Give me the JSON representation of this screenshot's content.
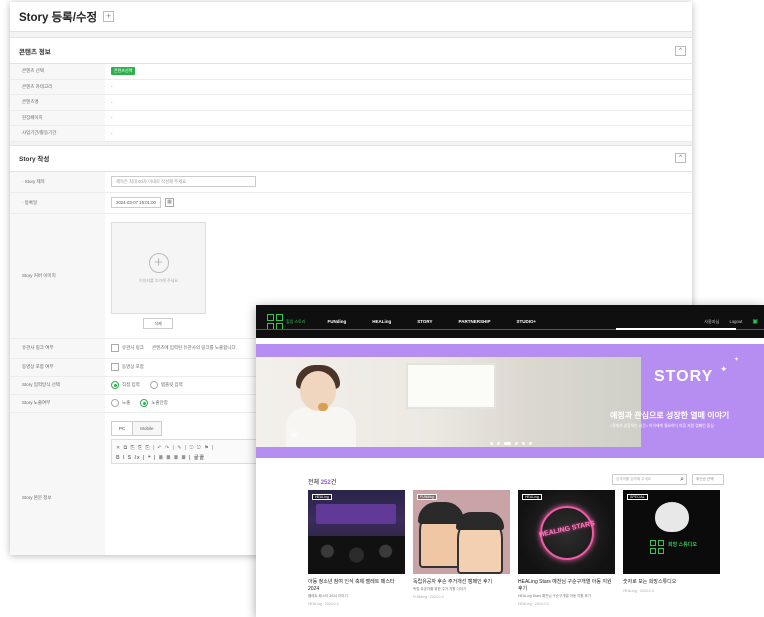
{
  "admin": {
    "title": "Story 등록/수정",
    "plus": "+",
    "content_section": {
      "label": "콘텐츠 정보",
      "collapse": "^",
      "rows": [
        {
          "label": "콘텐츠 선택",
          "value": "콘텐츠선택"
        },
        {
          "label": "콘텐츠 카테고리",
          "value": "-"
        },
        {
          "label": "콘텐츠명",
          "value": "-"
        },
        {
          "label": "현장페이지",
          "value": "-"
        },
        {
          "label": "사업기간/활동기간",
          "value": "-"
        }
      ]
    },
    "story_section": {
      "label": "Story 작성",
      "collapse": "^",
      "title_label": "· Story 제목",
      "title_placeholder": "제목은 최대 60자 이내로 작성해 주세요.",
      "date_label": "· 등록일",
      "date_value": "2024-03-07 16:01:00",
      "cover_label": "Story 커버 이미지",
      "cover_hint": "이미지를 추가해 주세요",
      "delete_label": "삭제",
      "related_label": "유관사 링크 여부",
      "related_value": "유관사 링크",
      "related_note": "콘텐츠에 입력된 유관사의 링크를 노출합니다.",
      "video_label": "동영상 포함 여부",
      "video_value": "동영상 포함",
      "input_label": "Story 입력방식 선택",
      "input_options": [
        "직접 입력",
        "템플릿 입력"
      ],
      "expose_label": "Story 노출여부",
      "expose_options": [
        "노출",
        "노출안함"
      ],
      "tabs": [
        "PC",
        "Mobile"
      ],
      "editor_row1": "✕ ⧉ ⎘ ⎘ ⎘ | ↶ ↷ | ✎ | ⎋ ⎋ ⚑ |",
      "editor_row2": "B I S Ix | ❝ | ≣ ≣ ≣ ≣ | 굴꼴",
      "body_label": "Story 본문 정보"
    }
  },
  "site": {
    "logo_text": "힐링 스토리",
    "menu": [
      "FUNding",
      "HEALing",
      "STORY",
      "PARTNERSHIP",
      "STUDIO+"
    ],
    "nav_right": [
      "사용자님",
      "Logout"
    ],
    "banner": {
      "title": "STORY",
      "subtitle": "애정과 관심으로 성장한 열매 이야기",
      "desc": "<열매가 성장하는 시간> 아이에게 필요하다 마음 지원 캠페인 중심"
    },
    "list": {
      "prefix": "전체 ",
      "count": "252",
      "suffix": "건",
      "search_placeholder": "검색어를 입력해 주세요",
      "sort": "최신순 선택"
    },
    "cards": [
      {
        "badge": "HEALing",
        "title": "아동 청소년 참여 인식 축제 멜레트 페스타 2024",
        "sub": "헬레트 페스타 2024 이야기",
        "meta": "HEALing · 2024.0.3"
      },
      {
        "badge": "FUNding",
        "title": "독립유공자 후손 주거개선 캠페인 후기",
        "sub": "독립 유공자를 위한 주거 지원 이야기",
        "meta": "FUNding · 2024.0.3"
      },
      {
        "badge": "HEALing",
        "title": "HEALing Stars 예천님 구순구개열 아동 지원 후기",
        "sub": "HEALing Stars 예천님 구순구개열 아동 지원 후기",
        "meta": "HEALing · 2024.0.3"
      },
      {
        "badge": "SPECIAL",
        "title": "숫자로 보는 희망스튜디오",
        "sub": "",
        "meta": "HEALing · 2024.0.3"
      }
    ],
    "card3_art": "HEALING STARS",
    "card4_art": "희망 스튜디오"
  }
}
